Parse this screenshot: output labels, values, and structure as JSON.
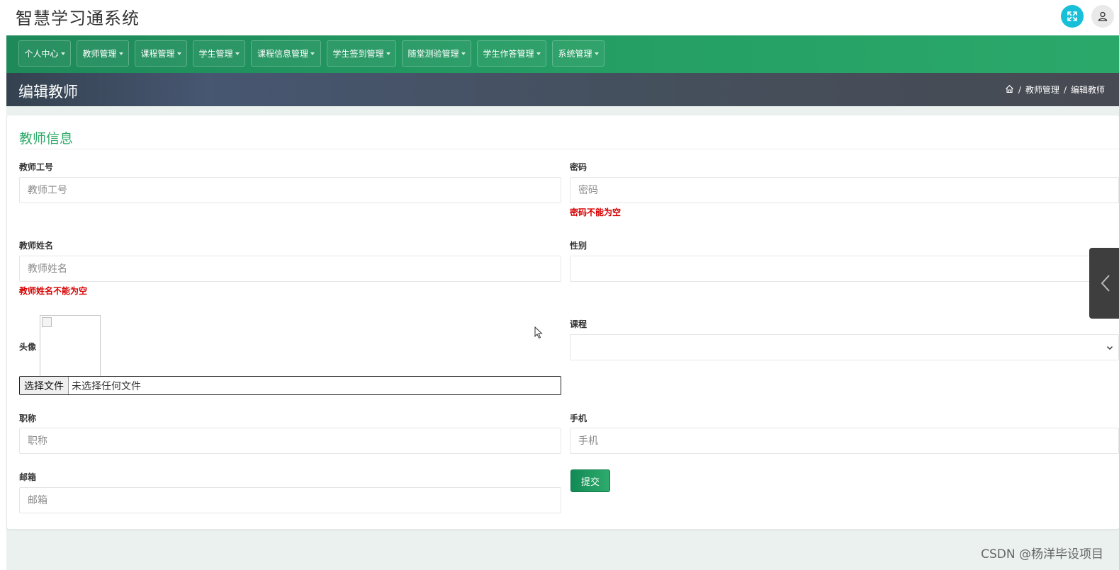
{
  "app": {
    "title": "智慧学习通系统"
  },
  "header_icons": {
    "fullscreen": "fullscreen-icon",
    "user": "user-icon",
    "fullscreen_color": "#17c0d8"
  },
  "nav": {
    "items": [
      {
        "label": "个人中心"
      },
      {
        "label": "教师管理"
      },
      {
        "label": "课程管理"
      },
      {
        "label": "学生管理"
      },
      {
        "label": "课程信息管理"
      },
      {
        "label": "学生签到管理"
      },
      {
        "label": "随堂测验管理"
      },
      {
        "label": "学生作答管理"
      },
      {
        "label": "系统管理"
      }
    ],
    "color": "#26a065"
  },
  "page": {
    "title": "编辑教师",
    "breadcrumb": {
      "separator": "/",
      "items": [
        "教师管理",
        "编辑教师"
      ]
    }
  },
  "form": {
    "section_title": "教师信息",
    "teacher_id": {
      "label": "教师工号",
      "placeholder": "教师工号"
    },
    "password": {
      "label": "密码",
      "placeholder": "密码",
      "error": "密码不能为空"
    },
    "teacher_name": {
      "label": "教师姓名",
      "placeholder": "教师姓名",
      "error": "教师姓名不能为空"
    },
    "gender": {
      "label": "性别",
      "value": ""
    },
    "avatar": {
      "label": "头像",
      "file_button": "选择文件",
      "file_status": "未选择任何文件"
    },
    "course": {
      "label": "课程",
      "value": ""
    },
    "title_field": {
      "label": "职称",
      "placeholder": "职称"
    },
    "phone": {
      "label": "手机",
      "placeholder": "手机"
    },
    "email": {
      "label": "邮箱",
      "placeholder": "邮箱"
    },
    "submit_label": "提交",
    "accent_color": "#2eaa6a",
    "error_color": "#d60000"
  },
  "watermark": "CSDN @杨洋毕设项目"
}
